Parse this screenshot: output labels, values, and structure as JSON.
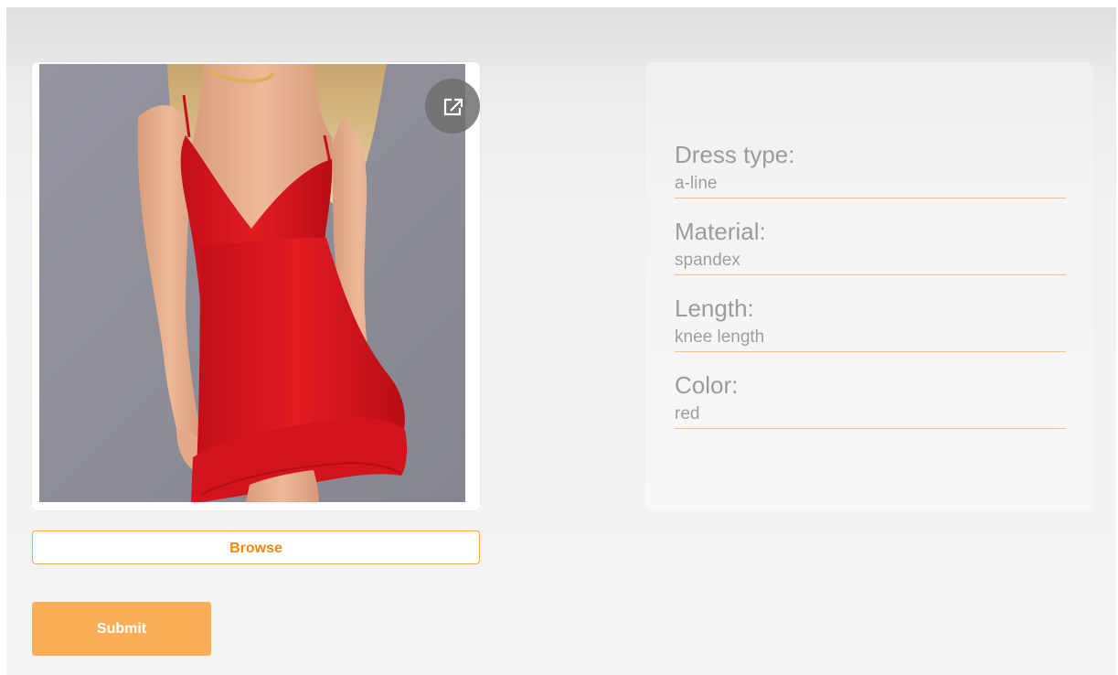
{
  "colors": {
    "accent": "#f08a0c",
    "submit_bg": "#fbae55",
    "divider": "#f2c08c",
    "dress_red": "#d8141c"
  },
  "image_viewer": {
    "expand_icon": "open-in-new-icon",
    "image_subject": "dress-photo"
  },
  "actions": {
    "browse_label": "Browse",
    "submit_label": "Submit"
  },
  "attributes": [
    {
      "label": "Dress type:",
      "value": "a-line"
    },
    {
      "label": "Material:",
      "value": "spandex"
    },
    {
      "label": "Length:",
      "value": "knee length"
    },
    {
      "label": "Color:",
      "value": "red"
    }
  ]
}
